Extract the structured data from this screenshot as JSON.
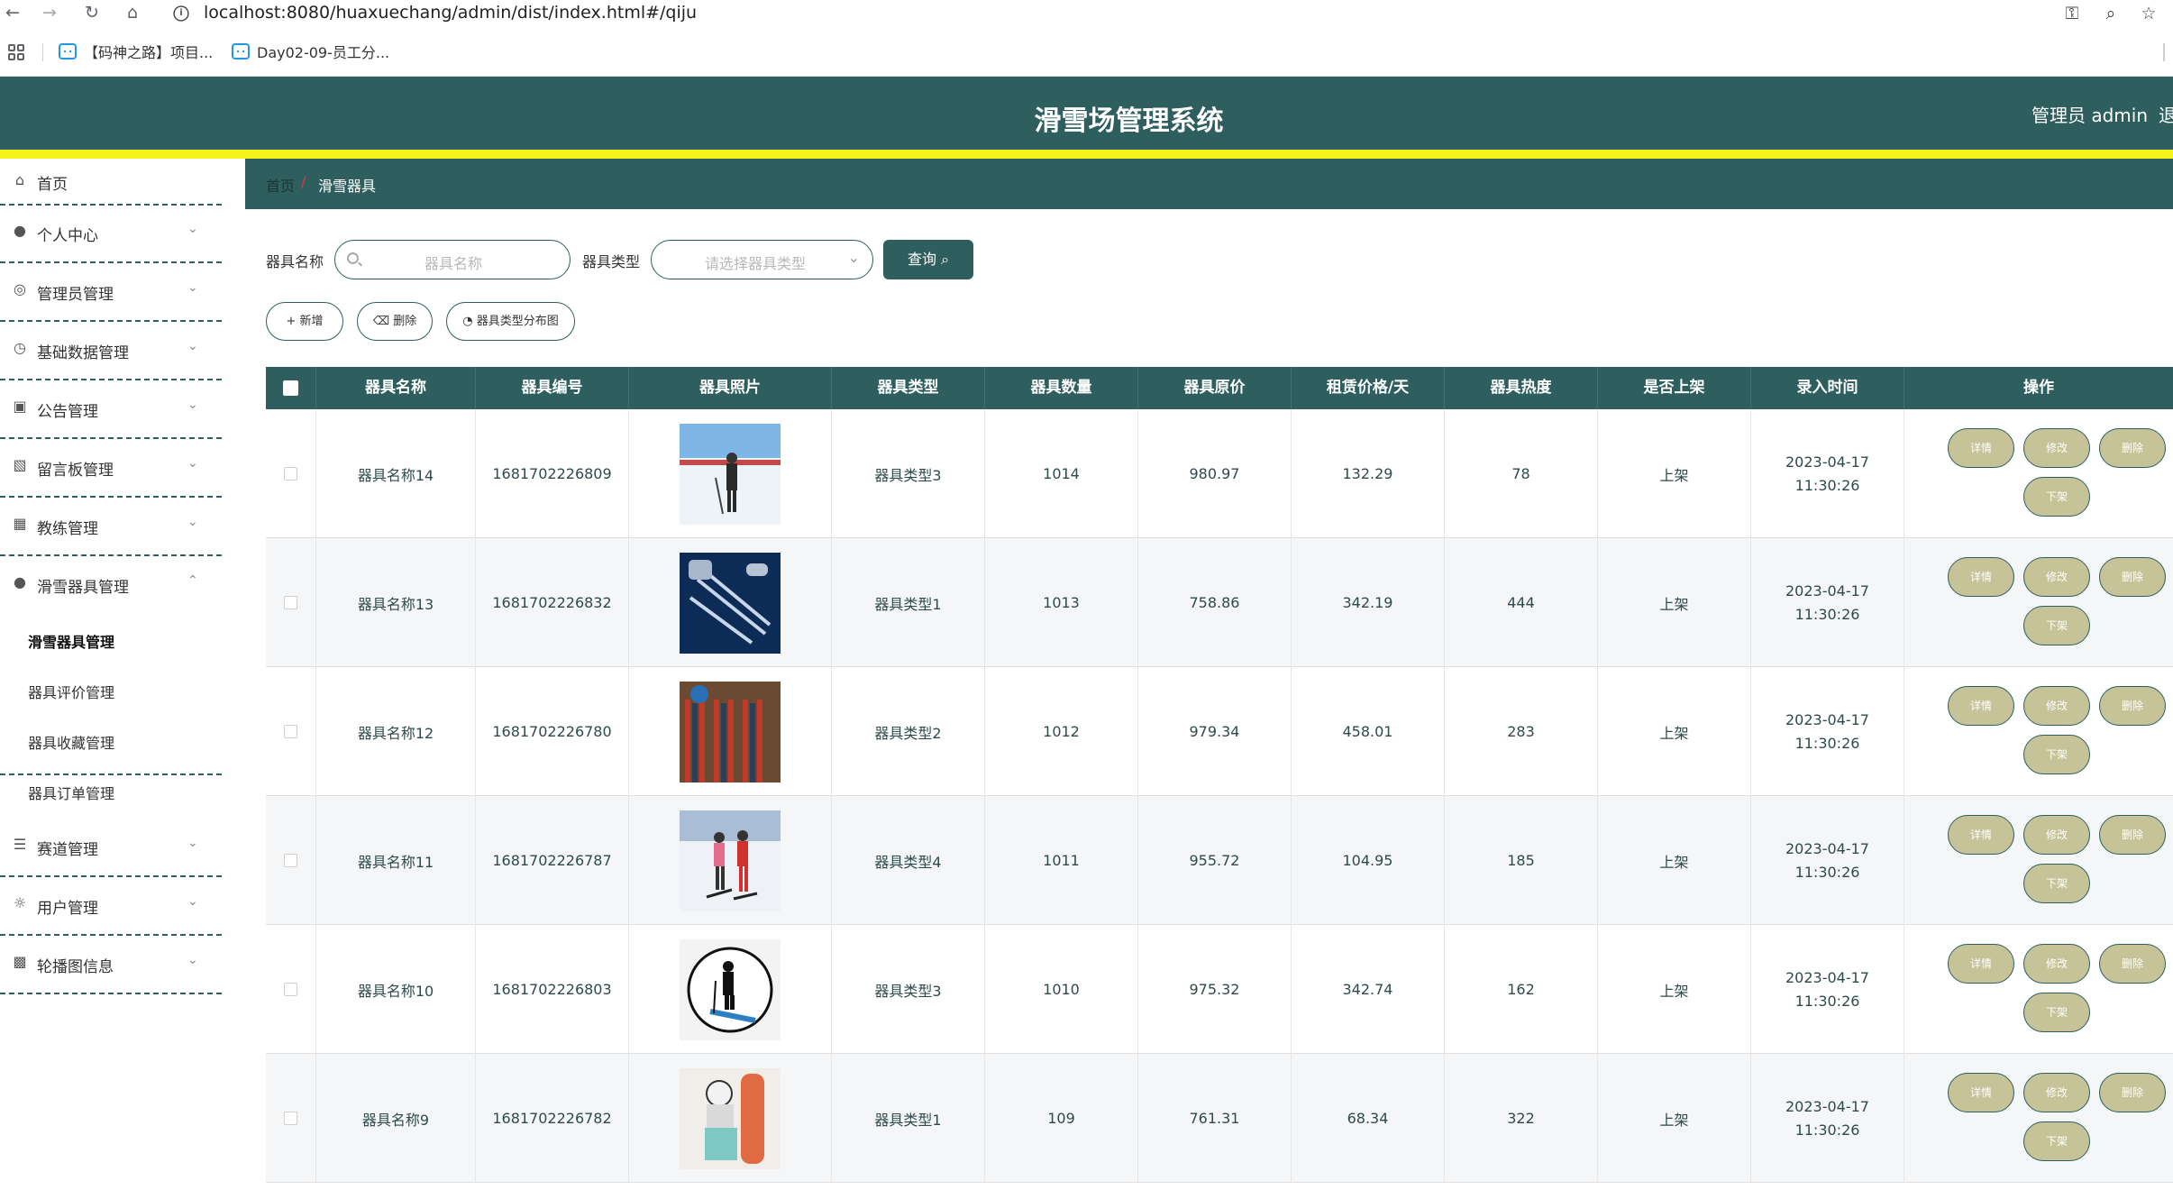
{
  "browser": {
    "url": "localhost:8080/huaxuechang/admin/dist/index.html#/qiju",
    "bookmarks": [
      "【码神之路】项目...",
      "Day02-09-员工分..."
    ]
  },
  "header": {
    "title": "滑雪场管理系统",
    "user": "管理员 admin",
    "logout": "退"
  },
  "sidebar": {
    "items": [
      {
        "label": "首页",
        "icon": "home-icon"
      },
      {
        "label": "个人中心",
        "icon": "user-icon"
      },
      {
        "label": "管理员管理",
        "icon": "admin-icon"
      },
      {
        "label": "基础数据管理",
        "icon": "clock-icon"
      },
      {
        "label": "公告管理",
        "icon": "notice-icon"
      },
      {
        "label": "留言板管理",
        "icon": "briefcase-icon"
      },
      {
        "label": "教练管理",
        "icon": "grid-icon"
      },
      {
        "label": "滑雪器具管理",
        "icon": "user-icon"
      },
      {
        "label": "赛道管理",
        "icon": "list-icon"
      },
      {
        "label": "用户管理",
        "icon": "globe-icon"
      },
      {
        "label": "轮播图信息",
        "icon": "chart-icon"
      }
    ],
    "submenu": [
      "滑雪器具管理",
      "器具评价管理",
      "器具收藏管理",
      "器具订单管理"
    ]
  },
  "breadcrumb": {
    "home": "首页",
    "separator": "/",
    "current": "滑雪器具"
  },
  "search": {
    "name_label": "器具名称",
    "name_placeholder": "器具名称",
    "type_label": "器具类型",
    "type_placeholder": "请选择器具类型",
    "query_button": "查询"
  },
  "actions": {
    "add": "新增",
    "delete": "删除",
    "chart": "器具类型分布图"
  },
  "table": {
    "columns": [
      "器具名称",
      "器具编号",
      "器具照片",
      "器具类型",
      "器具数量",
      "器具原价",
      "租赁价格/天",
      "器具热度",
      "是否上架",
      "录入时间",
      "操作"
    ],
    "row_buttons": {
      "detail": "详情",
      "edit": "修改",
      "delete": "删除",
      "offshelf": "下架"
    },
    "rows": [
      {
        "name": "器具名称14",
        "code": "1681702226809",
        "photo": "skier-on-slope",
        "type": "器具类型3",
        "qty": "1014",
        "price": "980.97",
        "rent": "132.29",
        "heat": "78",
        "status": "上架",
        "time": "2023-04-17 11:30:26"
      },
      {
        "name": "器具名称13",
        "code": "1681702226832",
        "photo": "ski-gear-set",
        "type": "器具类型1",
        "qty": "1013",
        "price": "758.86",
        "rent": "342.19",
        "heat": "444",
        "status": "上架",
        "time": "2023-04-17 11:30:26"
      },
      {
        "name": "器具名称12",
        "code": "1681702226780",
        "photo": "ski-rack",
        "type": "器具类型2",
        "qty": "1012",
        "price": "979.34",
        "rent": "458.01",
        "heat": "283",
        "status": "上架",
        "time": "2023-04-17 11:30:26"
      },
      {
        "name": "器具名称11",
        "code": "1681702226787",
        "photo": "two-skiers",
        "type": "器具类型4",
        "qty": "1011",
        "price": "955.72",
        "rent": "104.95",
        "heat": "185",
        "status": "上架",
        "time": "2023-04-17 11:30:26"
      },
      {
        "name": "器具名称10",
        "code": "1681702226803",
        "photo": "skier-logo",
        "type": "器具类型3",
        "qty": "1010",
        "price": "975.32",
        "rent": "342.74",
        "heat": "162",
        "status": "上架",
        "time": "2023-04-17 11:30:26"
      },
      {
        "name": "器具名称9",
        "code": "1681702226782",
        "photo": "snowboarder",
        "type": "器具类型1",
        "qty": "109",
        "price": "761.31",
        "rent": "68.34",
        "heat": "322",
        "status": "上架",
        "time": "2023-04-17 11:30:26"
      }
    ]
  },
  "colors": {
    "primary": "#2e5e5e",
    "accent_strip": "#f6f21b",
    "row_button": "#c5c397"
  }
}
